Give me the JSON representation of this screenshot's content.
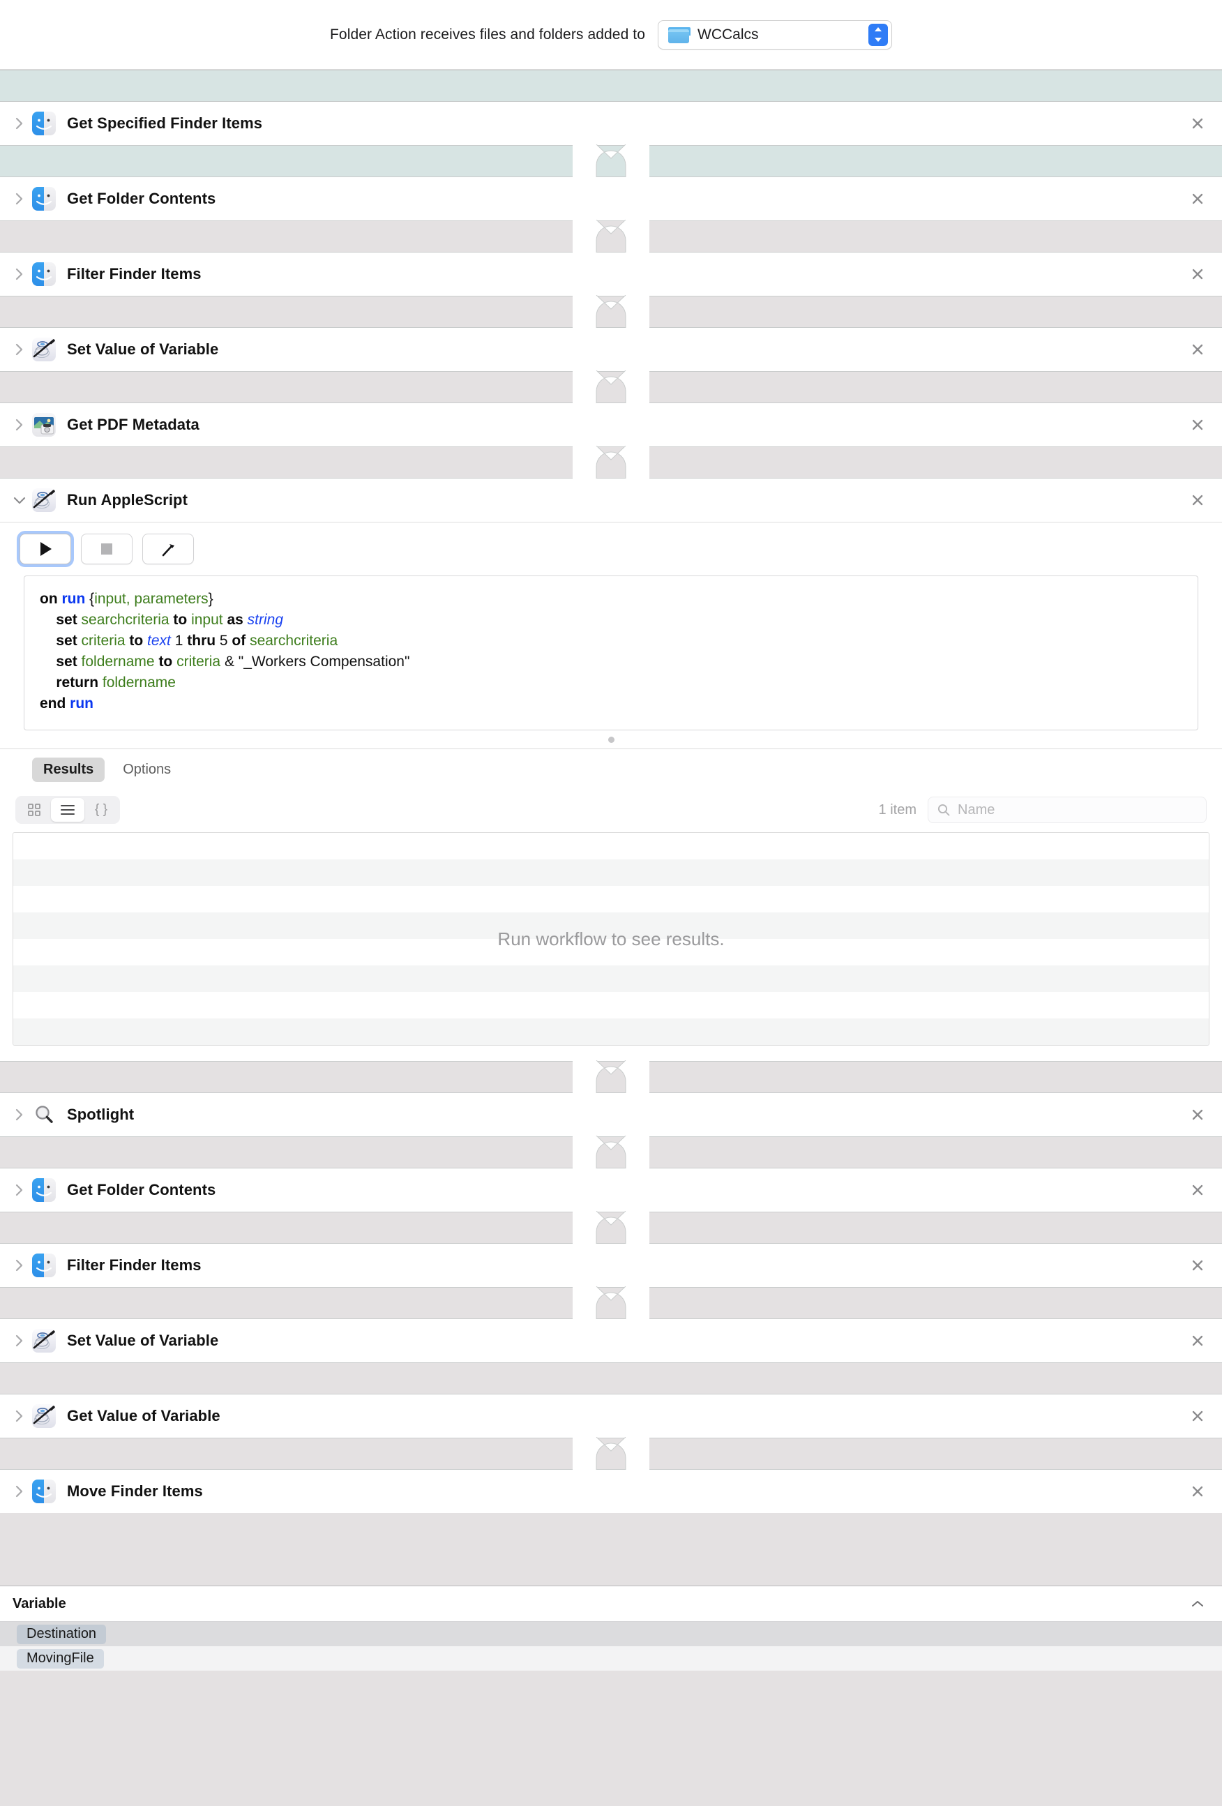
{
  "header": {
    "label": "Folder Action receives files and folders added to",
    "folder_popup": {
      "name": "WCCalcs",
      "icon": "folder-icon",
      "arrows_icon": "updown-chevrons-icon"
    }
  },
  "workflow": {
    "actions": [
      {
        "title": "Get Specified Finder Items",
        "icon": "finder-icon",
        "expanded": false,
        "gap_before": "teal",
        "notch_before": false
      },
      {
        "title": "Get Folder Contents",
        "icon": "finder-icon",
        "expanded": false,
        "gap_before": "teal",
        "notch_before": true
      },
      {
        "title": "Filter Finder Items",
        "icon": "finder-icon",
        "expanded": false,
        "gap_before": "grey",
        "notch_before": true
      },
      {
        "title": "Set Value of Variable",
        "icon": "automator-icon",
        "expanded": false,
        "gap_before": "grey",
        "notch_before": true
      },
      {
        "title": "Get PDF Metadata",
        "icon": "pdf-icon",
        "expanded": false,
        "gap_before": "grey",
        "notch_before": true
      },
      {
        "title": "Run AppleScript",
        "icon": "automator-icon",
        "expanded": true,
        "gap_before": "grey",
        "notch_before": true
      },
      {
        "title": "Spotlight",
        "icon": "spotlight-icon",
        "expanded": false,
        "gap_before": "grey",
        "notch_before": true
      },
      {
        "title": "Get Folder Contents",
        "icon": "finder-icon",
        "expanded": false,
        "gap_before": "grey",
        "notch_before": true
      },
      {
        "title": "Filter Finder Items",
        "icon": "finder-icon",
        "expanded": false,
        "gap_before": "grey",
        "notch_before": true
      },
      {
        "title": "Set Value of Variable",
        "icon": "automator-icon",
        "expanded": false,
        "gap_before": "grey",
        "notch_before": true
      },
      {
        "title": "Get Value of Variable",
        "icon": "automator-icon",
        "expanded": false,
        "gap_before": "plain",
        "notch_before": false
      },
      {
        "title": "Move Finder Items",
        "icon": "finder-icon",
        "expanded": false,
        "gap_before": "grey",
        "notch_before": true
      }
    ],
    "close_icon": "close-icon",
    "disclosure_collapsed_icon": "chevron-right-icon",
    "disclosure_expanded_icon": "chevron-down-icon"
  },
  "applescript": {
    "toolbar": {
      "run_icon": "play-icon",
      "stop_icon": "stop-icon",
      "compile_icon": "hammer-icon"
    },
    "code_lines": [
      [
        {
          "t": "on ",
          "c": "k"
        },
        {
          "t": "run ",
          "c": "kb"
        },
        {
          "t": "{",
          "c": "n"
        },
        {
          "t": "input, parameters",
          "c": "v"
        },
        {
          "t": "}",
          "c": "n"
        }
      ],
      [
        {
          "t": "    ",
          "c": "n"
        },
        {
          "t": "set ",
          "c": "k"
        },
        {
          "t": "searchcriteria ",
          "c": "v"
        },
        {
          "t": "to ",
          "c": "k"
        },
        {
          "t": "input ",
          "c": "v"
        },
        {
          "t": "as ",
          "c": "k"
        },
        {
          "t": "string",
          "c": "t"
        }
      ],
      [
        {
          "t": "    ",
          "c": "n"
        },
        {
          "t": "set ",
          "c": "k"
        },
        {
          "t": "criteria ",
          "c": "v"
        },
        {
          "t": "to ",
          "c": "k"
        },
        {
          "t": "text ",
          "c": "t"
        },
        {
          "t": "1 ",
          "c": "n"
        },
        {
          "t": "thru ",
          "c": "k"
        },
        {
          "t": "5 ",
          "c": "n"
        },
        {
          "t": "of ",
          "c": "k"
        },
        {
          "t": "searchcriteria",
          "c": "v"
        }
      ],
      [
        {
          "t": "    ",
          "c": "n"
        },
        {
          "t": "set ",
          "c": "k"
        },
        {
          "t": "foldername ",
          "c": "v"
        },
        {
          "t": "to ",
          "c": "k"
        },
        {
          "t": "criteria ",
          "c": "v"
        },
        {
          "t": "& \"_Workers Compensation\"",
          "c": "s"
        }
      ],
      [
        {
          "t": "    ",
          "c": "n"
        },
        {
          "t": "return ",
          "c": "k"
        },
        {
          "t": "foldername",
          "c": "v"
        }
      ],
      [
        {
          "t": "end ",
          "c": "k"
        },
        {
          "t": "run",
          "c": "kb"
        }
      ]
    ],
    "tabs": [
      {
        "label": "Results",
        "active": true
      },
      {
        "label": "Options",
        "active": false
      }
    ],
    "view_modes": [
      {
        "icon": "grid-view-icon",
        "active": false
      },
      {
        "icon": "list-view-icon",
        "active": true
      },
      {
        "icon": "braces-view-icon",
        "active": false
      }
    ],
    "item_count": "1 item",
    "search": {
      "placeholder": "Name",
      "value": "",
      "icon": "search-icon"
    },
    "results_empty_message": "Run workflow to see results."
  },
  "variables_panel": {
    "title": "Variable",
    "collapse_icon": "chevron-up-icon",
    "rows": [
      {
        "name": "Destination"
      },
      {
        "name": "MovingFile"
      }
    ]
  },
  "colors": {
    "accent_blue": "#2f7cf6",
    "gap_teal": "#d7e4e3",
    "gap_grey": "#e4e1e2",
    "keyword": "#0a0a0a",
    "keyword_blue": "#0a37f0",
    "variable_green": "#3d7d1c",
    "type_blue": "#1a42f0"
  }
}
